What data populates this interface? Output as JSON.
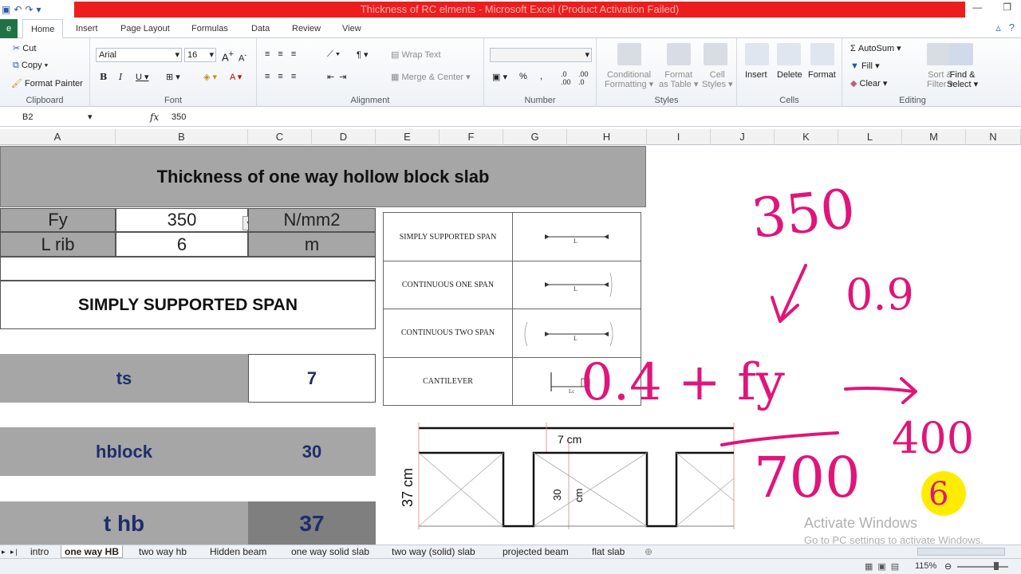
{
  "window": {
    "title": "Thickness of RC elments  -  Microsoft Excel (Product Activation Failed)"
  },
  "tabs": [
    "Home",
    "Insert",
    "Page Layout",
    "Formulas",
    "Data",
    "Review",
    "View"
  ],
  "ribbon": {
    "clipboard": {
      "cut": "Cut",
      "copy": "Copy",
      "format_painter": "Format Painter",
      "label": "Clipboard"
    },
    "font": {
      "name": "Arial",
      "size": "16",
      "label": "Font"
    },
    "alignment": {
      "wrap_text": "Wrap Text",
      "merge_center": "Merge & Center",
      "label": "Alignment"
    },
    "number": {
      "label": "Number"
    },
    "styles": {
      "conditional": "Conditional",
      "formatting": "Formatting",
      "format_as": "Format",
      "as_table": "as Table",
      "cell": "Cell",
      "cell_styles": "Styles",
      "label": "Styles"
    },
    "cells": {
      "insert": "Insert",
      "delete": "Delete",
      "format": "Format",
      "label": "Cells"
    },
    "editing": {
      "autosum": "AutoSum",
      "fill": "Fill",
      "clear": "Clear",
      "sort": "Sort &",
      "filter": "Filter",
      "find": "Find &",
      "select": "Select",
      "label": "Editing"
    }
  },
  "formula_bar": {
    "name_box": "B2",
    "fx": "fx",
    "value": "350"
  },
  "columns": [
    "A",
    "B",
    "C",
    "D",
    "E",
    "F",
    "G",
    "H",
    "I",
    "J",
    "K",
    "L",
    "M",
    "N"
  ],
  "sheet": {
    "title": "Thickness of  one way hollow block slab",
    "fy_label": "Fy",
    "fy_value": "350",
    "fy_unit": "N/mm2",
    "lrib_label": "L rib",
    "lrib_value": "6",
    "lrib_unit": "m",
    "span_type": "SIMPLY SUPPORTED SPAN",
    "ts_label": "ts",
    "ts_value": "7",
    "hblock_label": "hblock",
    "hblock_value": "30",
    "thb_label": "t hb",
    "thb_value": "37"
  },
  "span_table": [
    {
      "label": "SIMPLY SUPPORTED SPAN",
      "diagram_label": "L"
    },
    {
      "label": "CONTINUOUS ONE SPAN",
      "diagram_label": "L"
    },
    {
      "label": "CONTINUOUS TWO SPAN",
      "diagram_label": "L"
    },
    {
      "label": "CANTILEVER",
      "diagram_label": "Lc"
    }
  ],
  "section_diagram": {
    "top_label": "7 cm",
    "height_label": "37 cm",
    "block_label": "30",
    "block_unit": "cm"
  },
  "annotations": {
    "a1": "350",
    "a2": "0.9",
    "a3": "0.4 + fy",
    "a4": "700",
    "a5": "400",
    "a6": "6"
  },
  "sheet_tabs": [
    "intro",
    "one way HB",
    "two way hb",
    "Hidden beam",
    "one way solid slab",
    "two way (solid) slab",
    "projected beam",
    "flat slab"
  ],
  "active_sheet": "one way HB",
  "status": {
    "zoom": "115%"
  },
  "watermark": {
    "line1": "Activate Windows",
    "line2": "Go to PC settings to activate Windows."
  },
  "colors": {
    "title_bar": "#ee1d1d",
    "ink": "#e0157a",
    "gray_cell": "#a6a6a6",
    "navy_text": "#1f2d6b"
  }
}
